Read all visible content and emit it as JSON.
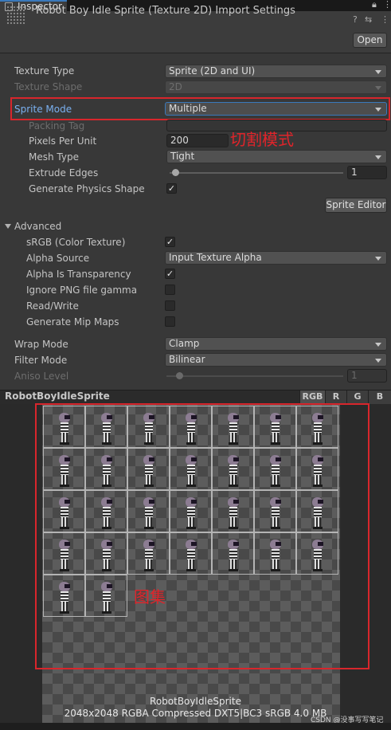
{
  "window": {
    "tab_label": "Inspector",
    "lock_icon": "lock-icon",
    "menu_icon": "kebab-menu-icon"
  },
  "header": {
    "title": "Robot Boy Idle Sprite (Texture 2D) Import Settings",
    "open_label": "Open"
  },
  "settings": {
    "texture_type": {
      "label": "Texture Type",
      "value": "Sprite (2D and UI)"
    },
    "texture_shape": {
      "label": "Texture Shape",
      "value": "2D"
    },
    "sprite_mode": {
      "label": "Sprite Mode",
      "value": "Multiple"
    },
    "packing_tag": {
      "label": "Packing Tag",
      "value": ""
    },
    "pixels_per_unit": {
      "label": "Pixels Per Unit",
      "value": "200"
    },
    "mesh_type": {
      "label": "Mesh Type",
      "value": "Tight"
    },
    "extrude_edges": {
      "label": "Extrude Edges",
      "value": "1"
    },
    "generate_physics_shape": {
      "label": "Generate Physics Shape",
      "checked": true
    },
    "sprite_editor_label": "Sprite Editor"
  },
  "advanced": {
    "label": "Advanced",
    "srgb": {
      "label": "sRGB (Color Texture)",
      "checked": true
    },
    "alpha_source": {
      "label": "Alpha Source",
      "value": "Input Texture Alpha"
    },
    "alpha_is_transparency": {
      "label": "Alpha Is Transparency",
      "checked": true
    },
    "ignore_png_gamma": {
      "label": "Ignore PNG file gamma",
      "checked": false
    },
    "read_write": {
      "label": "Read/Write",
      "checked": false
    },
    "generate_mip_maps": {
      "label": "Generate Mip Maps",
      "checked": false
    }
  },
  "wrap_mode": {
    "label": "Wrap Mode",
    "value": "Clamp"
  },
  "filter_mode": {
    "label": "Filter Mode",
    "value": "Bilinear"
  },
  "aniso_level": {
    "label": "Aniso Level",
    "value": "1"
  },
  "annotations": {
    "sprite_mode_note": "切割模式",
    "atlas_note": "图集"
  },
  "preview": {
    "name": "RobotBoyIdleSprite",
    "channels": [
      "RGB",
      "R",
      "G",
      "B"
    ],
    "info_name": "RobotBoyIdleSprite",
    "info_meta": "2048x2048  RGBA Compressed DXT5|BC3 sRGB  4.0 MB",
    "sprite_count": 30,
    "watermark": "CSDN @没事写写笔记"
  },
  "colors": {
    "accent": "#3a79bb",
    "annotation_red": "#d8262c",
    "sprite_mode_label": "#7ab0f0"
  }
}
